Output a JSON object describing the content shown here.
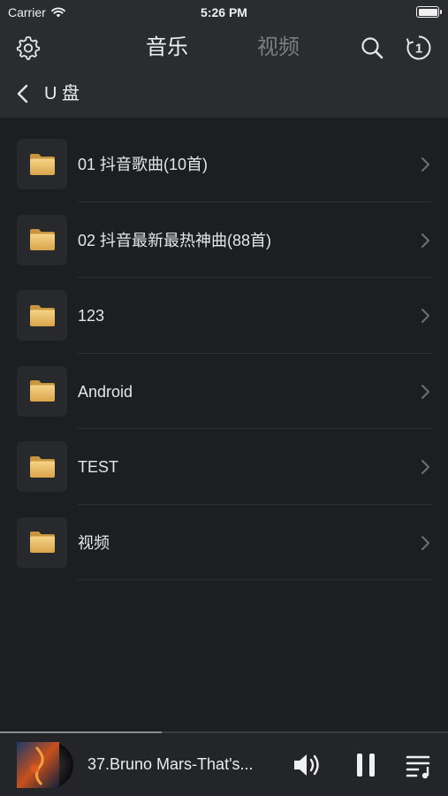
{
  "status": {
    "carrier": "Carrier",
    "time": "5:26 PM"
  },
  "header": {
    "tabs": [
      {
        "label": "音乐",
        "active": true
      },
      {
        "label": "视频",
        "active": false
      }
    ],
    "badge": "1"
  },
  "breadcrumb": {
    "title": "U 盘"
  },
  "folders": [
    {
      "name": "01 抖音歌曲(10首)"
    },
    {
      "name": "02 抖音最新最热神曲(88首)"
    },
    {
      "name": "123"
    },
    {
      "name": "Android"
    },
    {
      "name": "TEST"
    },
    {
      "name": "视频"
    }
  ],
  "player": {
    "track_title": "37.Bruno Mars-That's...",
    "progress": 0.36
  },
  "colors": {
    "background": "#1c1e21",
    "bar": "#2a2c30",
    "folder": "#e8b85a"
  }
}
